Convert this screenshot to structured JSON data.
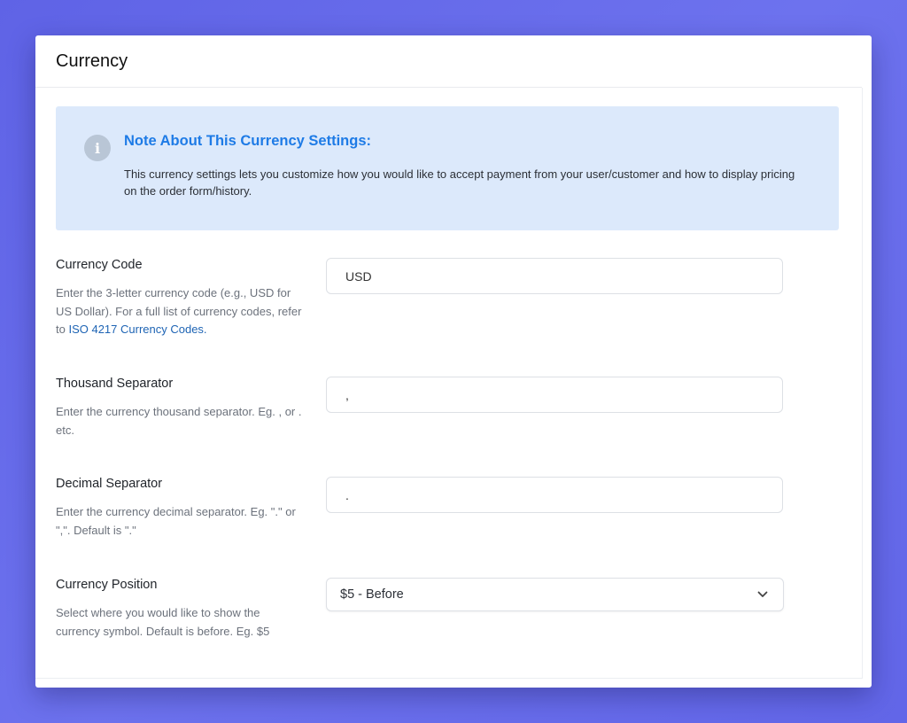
{
  "header": {
    "title": "Currency"
  },
  "notice": {
    "icon": "info-icon",
    "title": "Note About This Currency Settings:",
    "text": "This currency settings lets you customize how you would like to accept payment from your user/customer and how to display pricing on the order form/history."
  },
  "fields": {
    "currency_code": {
      "label": "Currency Code",
      "help_prefix": "Enter the 3-letter currency code (e.g., USD for US Dollar). For a full list of currency codes, refer to ",
      "help_link": "ISO 4217 Currency Codes.",
      "value": "USD"
    },
    "thousand_separator": {
      "label": "Thousand Separator",
      "help": "Enter the currency thousand separator. Eg. , or . etc.",
      "value": ","
    },
    "decimal_separator": {
      "label": "Decimal Separator",
      "help": "Enter the currency decimal separator. Eg. \".\" or \",\". Default is \".\"",
      "value": "."
    },
    "currency_position": {
      "label": "Currency Position",
      "help": "Select where you would like to show the currency symbol. Default is before. Eg. $5",
      "value": "$5 - Before",
      "icon": "chevron-down-icon"
    }
  },
  "colors": {
    "background": "#6469ea",
    "notice_bg": "#dce9fb",
    "notice_title": "#1e7be6",
    "link": "#1e64b4"
  }
}
